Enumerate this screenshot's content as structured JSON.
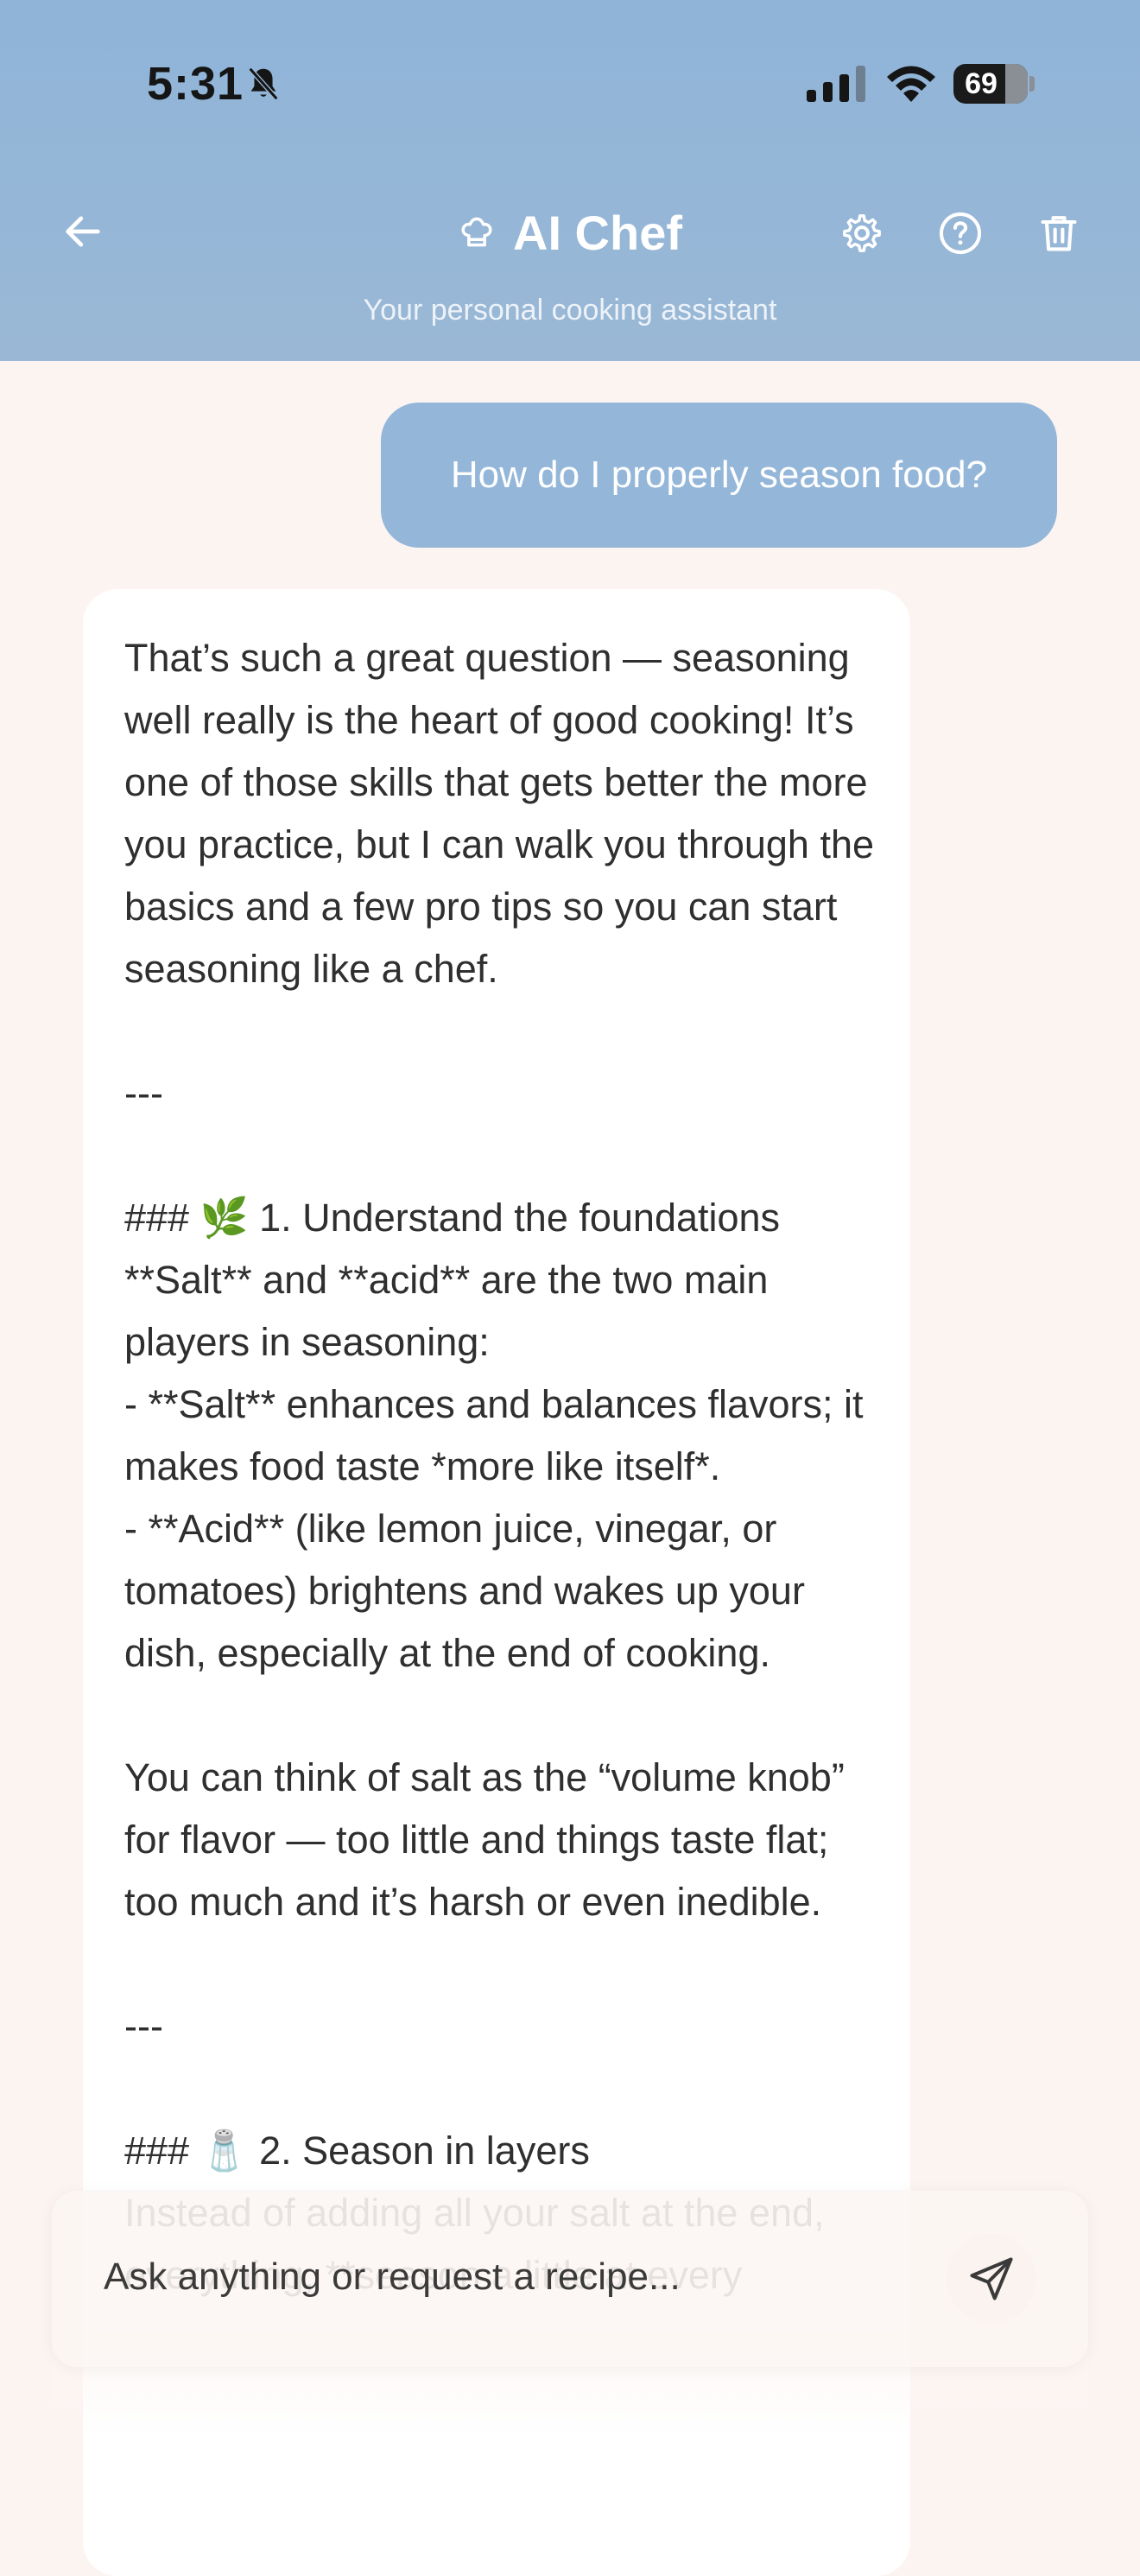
{
  "status_bar": {
    "time": "5:31",
    "battery": "69",
    "icons": [
      "bell-off-icon",
      "signal-icon",
      "wifi-icon",
      "battery-icon"
    ]
  },
  "header": {
    "title": "AI Chef",
    "subtitle": "Your personal cooking assistant",
    "icons": [
      "back-arrow-icon",
      "chef-hat-icon",
      "gear-icon",
      "help-circle-icon",
      "trash-icon"
    ],
    "background_color": "#8fb4d8"
  },
  "chat": {
    "user_message": "How do I properly season food?",
    "user_bubble_color": "#93b6d9",
    "assistant_message": "That’s such a great question — seasoning well really is the heart of good cooking! It’s one of those skills that gets better the more you practice, but I can walk you through the basics and a few pro tips so you can start seasoning like a chef.\n\n---\n\n### 🌿 1. Understand the foundations\n**Salt** and **acid** are the two main players in seasoning:\n- **Salt** enhances and balances flavors; it makes food taste *more like itself*.\n- **Acid** (like lemon juice, vinegar, or tomatoes) brightens and wakes up your dish, especially at the end of cooking.\n\nYou can think of salt as the “volume knob” for flavor — too little and things taste flat; too much and it’s harsh or even inedible.\n\n---\n\n### 🧂 2. Season in layers\nInstead of adding all your salt at the end,\neverything, **season a little at every"
  },
  "composer": {
    "placeholder": "Ask anything or request a recipe...",
    "value": "",
    "send_icon": "send-icon"
  },
  "colors": {
    "page_background": "#fcf4f1",
    "assistant_bubble": "#ffffff"
  }
}
